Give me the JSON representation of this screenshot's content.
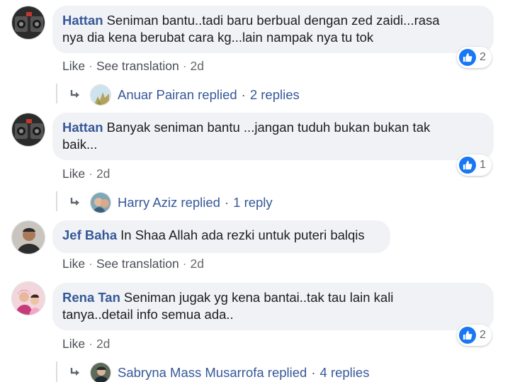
{
  "comments": [
    {
      "author": "Hattan",
      "text": "Seniman bantu..tadi baru berbual dengan zed zaidi...rasa nya dia kena berubat cara kg...lain nampak nya tu tok",
      "line1": "Seniman bantu..tadi baru berbual dengan zed zaidi...rasa",
      "line2": "nya dia kena berubat cara kg...lain nampak nya tu tok",
      "actions": {
        "like": "Like",
        "translate": "See translation",
        "time": "2d"
      },
      "reaction_count": "2",
      "replies": {
        "name": "Anuar Pairan replied",
        "count": "2 replies"
      }
    },
    {
      "author": "Hattan",
      "text": "Banyak seniman bantu ...jangan tuduh bukan bukan tak baik...",
      "line1": "Banyak seniman bantu ...jangan tuduh bukan bukan tak",
      "line2": "baik...",
      "actions": {
        "like": "Like",
        "time": "2d"
      },
      "reaction_count": "1",
      "replies": {
        "name": "Harry Aziz replied",
        "count": "1 reply"
      }
    },
    {
      "author": "Jef Baha",
      "text": "In Shaa Allah ada rezki untuk puteri balqis",
      "actions": {
        "like": "Like",
        "translate": "See translation",
        "time": "2d"
      }
    },
    {
      "author": "Rena Tan",
      "text": "Seniman jugak yg kena bantai..tak tau lain kali tanya..detail info semua ada..",
      "line1": "Seniman jugak yg kena bantai..tak tau lain kali",
      "line2": "tanya..detail info semua ada..",
      "actions": {
        "like": "Like",
        "time": "2d"
      },
      "reaction_count": "2",
      "replies": {
        "name": "Sabryna Mass Musarrofa replied",
        "count": "4 replies"
      }
    }
  ],
  "separator": "·",
  "colors": {
    "author": "#365899",
    "bubble": "#f0f2f5",
    "like_badge": "#1877f2"
  },
  "icons": [
    "reply-arrow-icon",
    "like-thumb-icon"
  ]
}
